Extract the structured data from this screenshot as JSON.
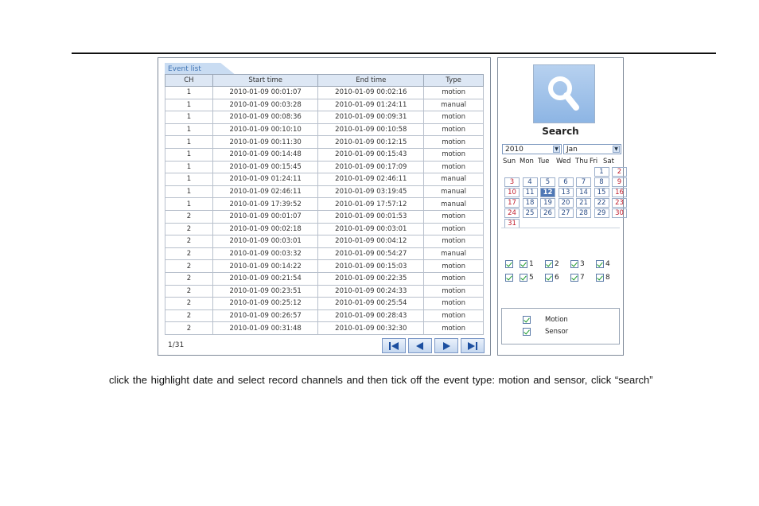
{
  "event_list": {
    "tab_label": "Event list",
    "columns": [
      "CH",
      "Start time",
      "End time",
      "Type"
    ],
    "rows": [
      [
        "1",
        "2010-01-09 00:01:07",
        "2010-01-09 00:02:16",
        "motion"
      ],
      [
        "1",
        "2010-01-09 00:03:28",
        "2010-01-09 01:24:11",
        "manual"
      ],
      [
        "1",
        "2010-01-09 00:08:36",
        "2010-01-09 00:09:31",
        "motion"
      ],
      [
        "1",
        "2010-01-09 00:10:10",
        "2010-01-09 00:10:58",
        "motion"
      ],
      [
        "1",
        "2010-01-09 00:11:30",
        "2010-01-09 00:12:15",
        "motion"
      ],
      [
        "1",
        "2010-01-09 00:14:48",
        "2010-01-09 00:15:43",
        "motion"
      ],
      [
        "1",
        "2010-01-09 00:15:45",
        "2010-01-09 00:17:09",
        "motion"
      ],
      [
        "1",
        "2010-01-09 01:24:11",
        "2010-01-09 02:46:11",
        "manual"
      ],
      [
        "1",
        "2010-01-09 02:46:11",
        "2010-01-09 03:19:45",
        "manual"
      ],
      [
        "1",
        "2010-01-09 17:39:52",
        "2010-01-09 17:57:12",
        "manual"
      ],
      [
        "2",
        "2010-01-09 00:01:07",
        "2010-01-09 00:01:53",
        "motion"
      ],
      [
        "2",
        "2010-01-09 00:02:18",
        "2010-01-09 00:03:01",
        "motion"
      ],
      [
        "2",
        "2010-01-09 00:03:01",
        "2010-01-09 00:04:12",
        "motion"
      ],
      [
        "2",
        "2010-01-09 00:03:32",
        "2010-01-09 00:54:27",
        "manual"
      ],
      [
        "2",
        "2010-01-09 00:14:22",
        "2010-01-09 00:15:03",
        "motion"
      ],
      [
        "2",
        "2010-01-09 00:21:54",
        "2010-01-09 00:22:35",
        "motion"
      ],
      [
        "2",
        "2010-01-09 00:23:51",
        "2010-01-09 00:24:33",
        "motion"
      ],
      [
        "2",
        "2010-01-09 00:25:12",
        "2010-01-09 00:25:54",
        "motion"
      ],
      [
        "2",
        "2010-01-09 00:26:57",
        "2010-01-09 00:28:43",
        "motion"
      ],
      [
        "2",
        "2010-01-09 00:31:48",
        "2010-01-09 00:32:30",
        "motion"
      ]
    ],
    "page_info": "1/31",
    "pager_icons": [
      "first-page-icon",
      "prev-page-icon",
      "next-page-icon",
      "last-page-icon"
    ]
  },
  "search": {
    "button_icon": "magnifier-icon",
    "label": "Search",
    "year": "2010",
    "month": "Jan",
    "weekdays": [
      "Sun",
      "Mon",
      "Tue",
      "Wed",
      "Thu",
      "Fri",
      "Sat"
    ],
    "first_weekday_index": 5,
    "days_in_month": 31,
    "selected_day": 12,
    "highlighted_days": [
      3,
      4,
      5,
      6,
      7,
      8,
      9,
      10,
      12,
      13,
      14,
      15,
      16,
      17,
      18,
      19,
      20,
      21,
      22,
      23,
      24,
      25,
      26,
      27,
      28,
      29,
      30,
      31
    ],
    "boxed_days": [
      1,
      2,
      3,
      4,
      5,
      6,
      7,
      8,
      9,
      10,
      11,
      12,
      13,
      14,
      15,
      16,
      17,
      18,
      19,
      20,
      21,
      22,
      23,
      24,
      25,
      26,
      27,
      28,
      29,
      30,
      31
    ],
    "channels_row1": [
      "1",
      "2",
      "3",
      "4"
    ],
    "channels_row2": [
      "5",
      "6",
      "7",
      "8"
    ],
    "event_types": [
      "Motion",
      "Sensor"
    ],
    "colors": {
      "weekend": "#c01f2f",
      "weekday": "#2d4f88",
      "selected": "#4f78b6"
    }
  },
  "caption": "click the highlight date and select record channels and then tick off the event type: motion and sensor, click “search”"
}
